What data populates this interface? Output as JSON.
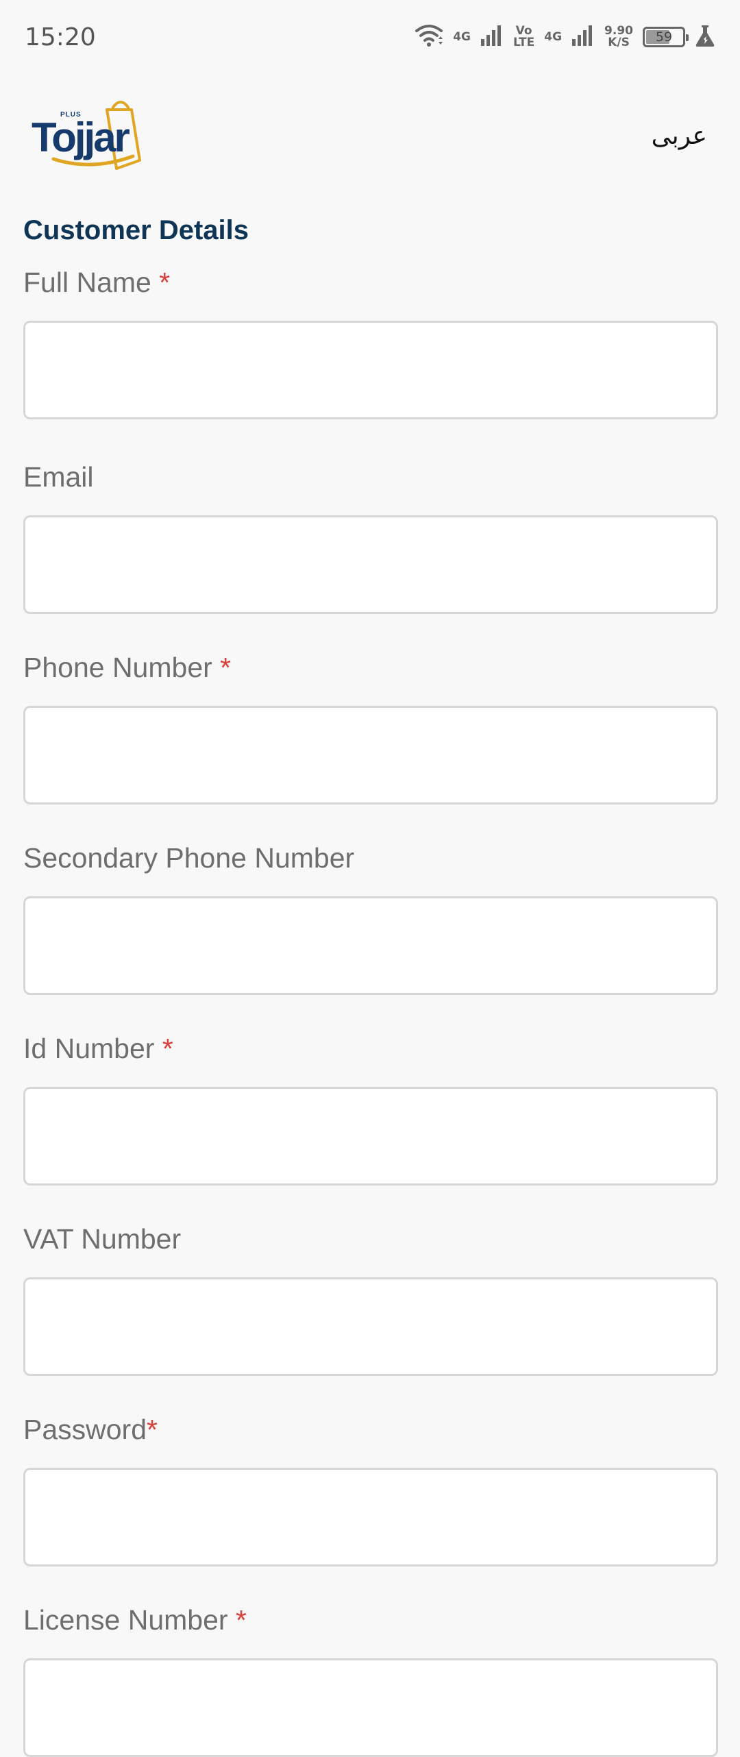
{
  "status_bar": {
    "time": "15:20",
    "net1": "4G",
    "volte_top": "Vo",
    "volte_bottom": "LTE",
    "net2": "4G",
    "speed_value": "9.90",
    "speed_unit": "K/S",
    "battery": "59"
  },
  "header": {
    "logo_text": "Tojjar",
    "logo_plus": "PLUS",
    "language_link": "عربى"
  },
  "form": {
    "section_title": "Customer Details",
    "required_mark": "*",
    "fields": [
      {
        "label": "Full Name ",
        "required": true,
        "value": ""
      },
      {
        "label": "Email",
        "required": false,
        "value": ""
      },
      {
        "label": "Phone Number ",
        "required": true,
        "value": ""
      },
      {
        "label": "Secondary Phone Number",
        "required": false,
        "value": ""
      },
      {
        "label": "Id Number ",
        "required": true,
        "value": ""
      },
      {
        "label": "VAT Number",
        "required": false,
        "value": ""
      },
      {
        "label": "Password",
        "required": true,
        "value": ""
      },
      {
        "label": "License Number ",
        "required": true,
        "value": ""
      }
    ]
  },
  "colors": {
    "background": "#f8f8f8",
    "title": "#0e3556",
    "label": "#6e6e6e",
    "required": "#d9413b",
    "input_border": "#d6d6d6",
    "logo_blue": "#173a6c",
    "logo_gold": "#e0a623"
  }
}
